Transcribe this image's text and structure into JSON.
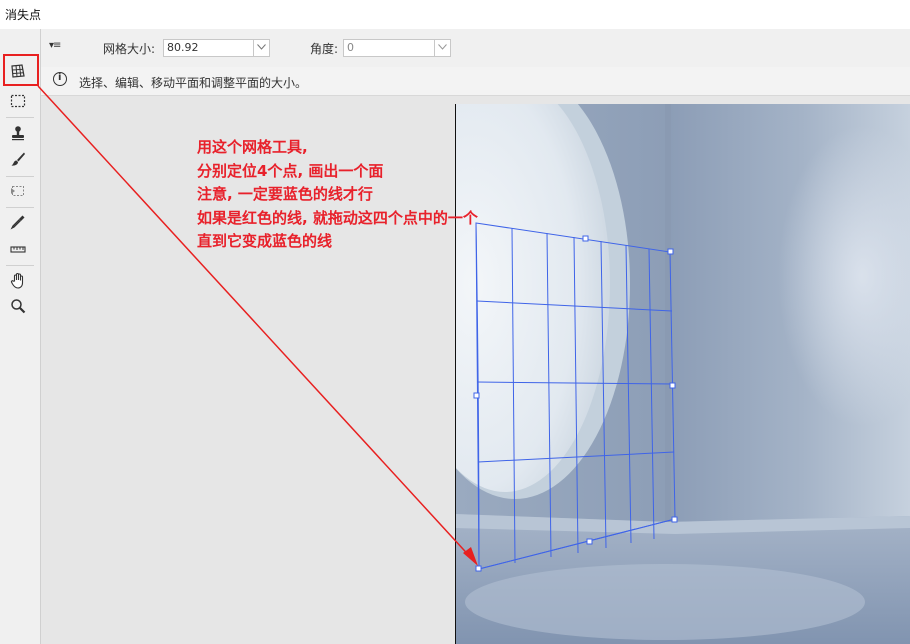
{
  "window": {
    "title": "消失点"
  },
  "options": {
    "grid_size_label": "网格大小:",
    "grid_size_value": "80.92",
    "angle_label": "角度:",
    "angle_value": "0"
  },
  "info": {
    "text": "选择、编辑、移动平面和调整平面的大小。"
  },
  "tools": [
    {
      "name": "edit-plane-tool",
      "icon": "grid-plane-icon",
      "selected": true
    },
    {
      "name": "marquee-tool",
      "icon": "marquee-icon"
    },
    {
      "name": "stamp-tool",
      "icon": "stamp-icon"
    },
    {
      "name": "brush-tool",
      "icon": "brush-icon"
    },
    {
      "name": "transform-tool",
      "icon": "transform-icon"
    },
    {
      "name": "eyedropper-tool",
      "icon": "eyedropper-icon"
    },
    {
      "name": "measure-tool",
      "icon": "ruler-icon"
    },
    {
      "name": "hand-tool",
      "icon": "hand-icon"
    },
    {
      "name": "zoom-tool",
      "icon": "zoom-icon"
    }
  ],
  "annotation": {
    "lines": [
      "用这个网格工具,",
      "分别定位4个点, 画出一个面",
      "注意, 一定要蓝色的线才行",
      "如果是红色的线, 就拖动这四个点中的一个",
      "直到它变成蓝色的线"
    ],
    "color": "#e8212b"
  },
  "colors": {
    "grid": "#3f64e8",
    "highlight": "#e82020"
  }
}
